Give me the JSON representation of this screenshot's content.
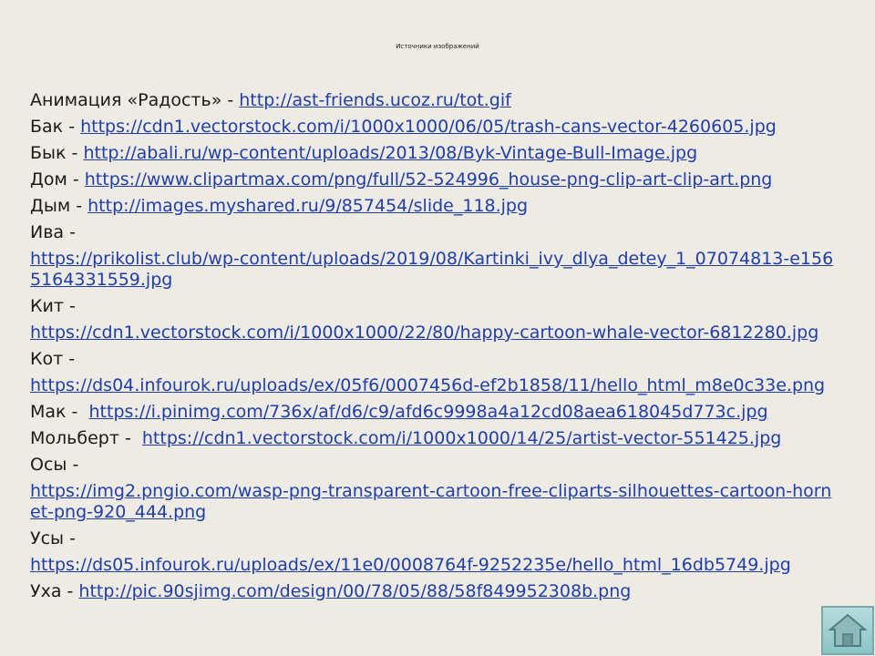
{
  "title": "Источники изображений",
  "entries": [
    {
      "name": "Анимация «Радость»",
      "sep": " - ",
      "url": "http://ast-friends.ucoz.ru/tot.gif",
      "wrap": false
    },
    {
      "name": "Бак",
      "sep": " - ",
      "url": "https://cdn1.vectorstock.com/i/1000x1000/06/05/trash-cans-vector-4260605.jpg",
      "wrap": false
    },
    {
      "name": "Бык",
      "sep": " - ",
      "url": "http://abali.ru/wp-content/uploads/2013/08/Byk-Vintage-Bull-Image.jpg",
      "wrap": false
    },
    {
      "name": "Дом",
      "sep": " - ",
      "url": "https://www.clipartmax.com/png/full/52-524996_house-png-clip-art-clip-art.png",
      "wrap": false
    },
    {
      "name": "Дым",
      "sep": " - ",
      "url": "http://images.myshared.ru/9/857454/slide_118.jpg",
      "wrap": false
    },
    {
      "name": "Ива",
      "sep": " - ",
      "url": "https://prikolist.club/wp-content/uploads/2019/08/Kartinki_ivy_dlya_detey_1_07074813-e1565164331559.jpg",
      "wrap": true
    },
    {
      "name": "Кит",
      "sep": " - ",
      "url": "https://cdn1.vectorstock.com/i/1000x1000/22/80/happy-cartoon-whale-vector-6812280.jpg",
      "wrap": true
    },
    {
      "name": "Кот",
      "sep": " - ",
      "url": "https://ds04.infourok.ru/uploads/ex/05f6/0007456d-ef2b1858/11/hello_html_m8e0c33e.png",
      "wrap": true
    },
    {
      "name": "Мак",
      "sep": " -  ",
      "url": "https://i.pinimg.com/736x/af/d6/c9/afd6c9998a4a12cd08aea618045d773c.jpg",
      "wrap": false
    },
    {
      "name": "Мольберт",
      "sep": " -  ",
      "url": "https://cdn1.vectorstock.com/i/1000x1000/14/25/artist-vector-551425.jpg",
      "wrap": false
    },
    {
      "name": "Осы",
      "sep": " - ",
      "url": "https://img2.pngio.com/wasp-png-transparent-cartoon-free-cliparts-silhouettes-cartoon-hornet-png-920_444.png",
      "wrap": true
    },
    {
      "name": "Усы",
      "sep": " - ",
      "url": "https://ds05.infourok.ru/uploads/ex/11e0/0008764f-9252235e/hello_html_16db5749.jpg",
      "wrap": true
    },
    {
      "name": "Уха",
      "sep": " - ",
      "url": "http://pic.90sjimg.com/design/00/78/05/88/58f849952308b.png",
      "wrap": false
    }
  ],
  "home_button": {
    "icon": "home-icon"
  },
  "colors": {
    "background": "#eeebe4",
    "link": "#1f3ea8",
    "text": "#1a1a1a",
    "home_button": "#9fd0d1"
  }
}
